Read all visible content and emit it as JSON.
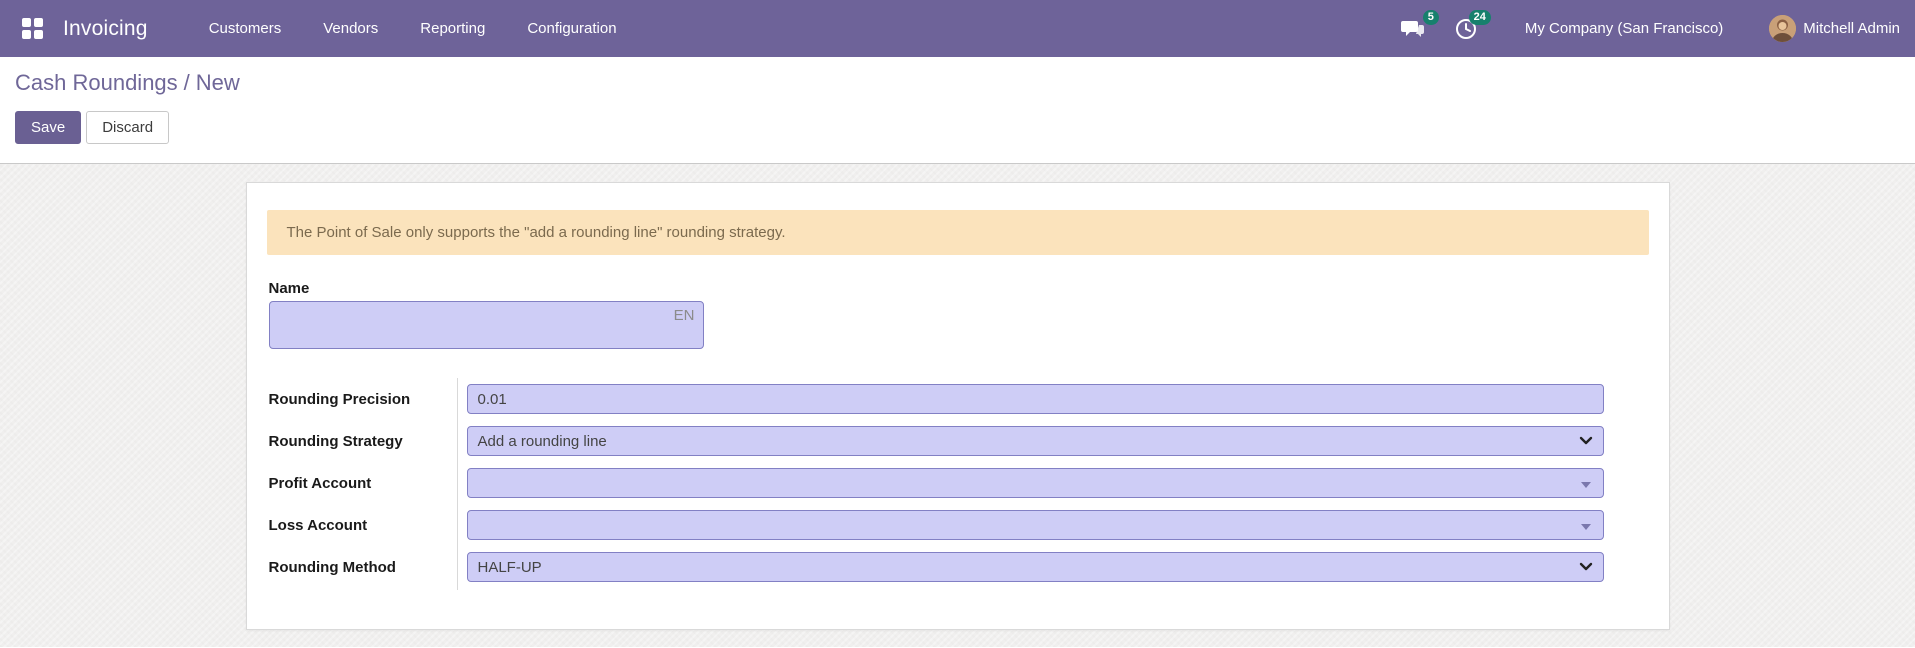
{
  "app": {
    "name": "Invoicing"
  },
  "nav": {
    "menus": [
      {
        "label": "Customers"
      },
      {
        "label": "Vendors"
      },
      {
        "label": "Reporting"
      },
      {
        "label": "Configuration"
      }
    ],
    "messages_badge": "5",
    "activities_badge": "24",
    "company": "My Company (San Francisco)",
    "user": "Mitchell Admin",
    "icons": [
      "apps-grid-icon",
      "chat-icon",
      "clock-icon",
      "user-avatar"
    ]
  },
  "breadcrumb": {
    "parent": "Cash Roundings",
    "separator": "/",
    "current": "New"
  },
  "actions": {
    "save": "Save",
    "discard": "Discard"
  },
  "alert": {
    "text": "The Point of Sale only supports the \"add a rounding line\" rounding strategy."
  },
  "form": {
    "name": {
      "label": "Name",
      "value": "",
      "lang_badge": "EN"
    },
    "fields": [
      {
        "label": "Rounding Precision",
        "value": "0.01",
        "type": "input"
      },
      {
        "label": "Rounding Strategy",
        "value": "Add a rounding line",
        "type": "select"
      },
      {
        "label": "Profit Account",
        "value": "",
        "type": "many2one"
      },
      {
        "label": "Loss Account",
        "value": "",
        "type": "many2one"
      },
      {
        "label": "Rounding Method",
        "value": "HALF-UP",
        "type": "select"
      }
    ]
  },
  "colors": {
    "navbar": "#6e6399",
    "badge": "#17806d",
    "breadcrumb": "#6f6798",
    "save_button": "#6a6093",
    "field_background": "#cecdf6",
    "field_border": "#8280c4",
    "alert_background": "#fbe3bc",
    "alert_text": "#7b6a4e",
    "content_background": "#f0efee"
  }
}
